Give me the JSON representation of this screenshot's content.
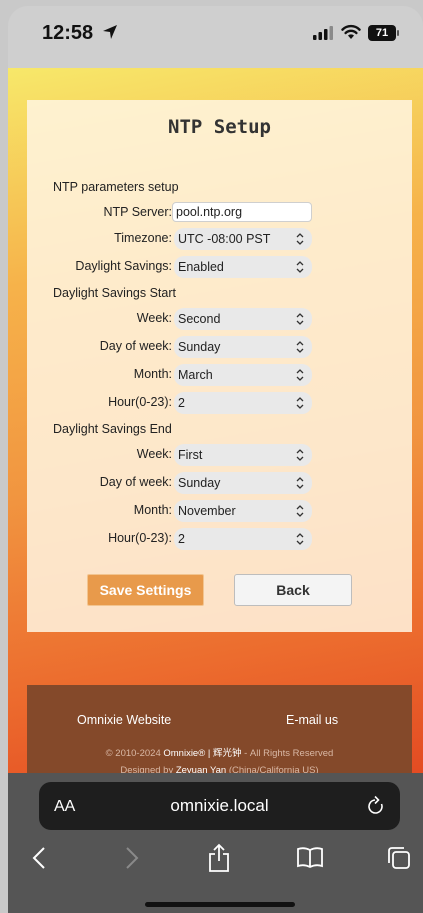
{
  "status_bar": {
    "time": "12:58",
    "battery": "71"
  },
  "page": {
    "title": "NTP Setup",
    "ntp_section_label": "NTP parameters setup",
    "ntp_server_label": "NTP Server:",
    "ntp_server_value": "pool.ntp.org",
    "timezone_label": "Timezone:",
    "timezone_value": "UTC -08:00 PST",
    "daylight_label": "Daylight Savings:",
    "daylight_value": "Enabled",
    "dst_start_section": "Daylight Savings Start",
    "dst_start": {
      "week_label": "Week:",
      "week_value": "Second",
      "dow_label": "Day of week:",
      "dow_value": "Sunday",
      "month_label": "Month:",
      "month_value": "March",
      "hour_label": "Hour(0-23):",
      "hour_value": "2"
    },
    "dst_end_section": "Daylight Savings End",
    "dst_end": {
      "week_label": "Week:",
      "week_value": "First",
      "dow_label": "Day of week:",
      "dow_value": "Sunday",
      "month_label": "Month:",
      "month_value": "November",
      "hour_label": "Hour(0-23):",
      "hour_value": "2"
    },
    "save_label": "Save Settings",
    "back_label": "Back"
  },
  "footer": {
    "website_link": "Omnixie Website",
    "email_link": "E-mail us",
    "copyright_prefix": "© 2010-2024",
    "copyright_brand": "Omnixie® | 辉光钟",
    "copyright_suffix": "- All Rights Reserved",
    "designed_prefix": "Designed by",
    "designer": "Zeyuan Yan",
    "designer_location": "(China/California US)"
  },
  "browser": {
    "aa_label": "AA",
    "url": "omnixie.local"
  },
  "colors": {
    "save_button": "#e89a4b",
    "footer_bg": "#84492a",
    "gradient_top": "#f7e86a",
    "gradient_bottom": "#e34a22"
  },
  "icons": [
    "location-arrow-icon",
    "signal-icon",
    "wifi-icon",
    "battery-icon",
    "reload-icon",
    "back-icon",
    "forward-icon",
    "share-icon",
    "bookmarks-icon",
    "tabs-icon"
  ]
}
